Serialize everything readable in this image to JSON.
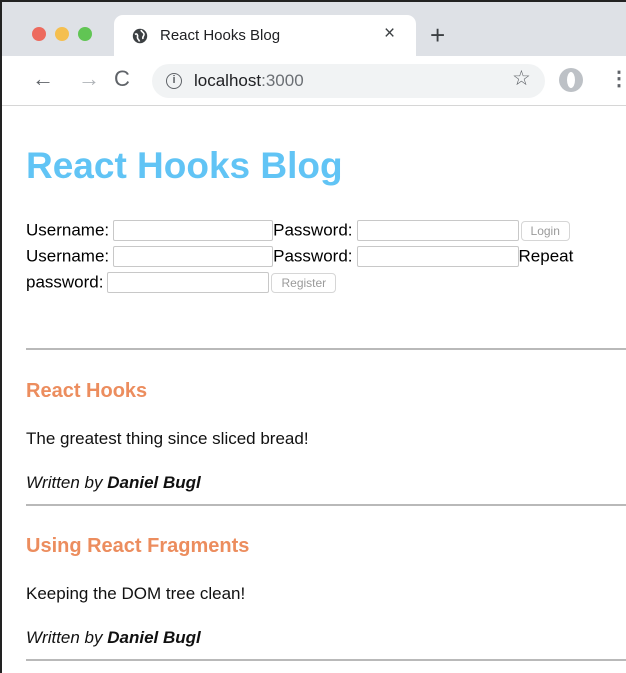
{
  "browser": {
    "tab_title": "React Hooks Blog",
    "tab_close": "×",
    "new_tab": "+",
    "url_host": "localhost",
    "url_port": ":3000",
    "info_glyph": "i",
    "icons": [
      "close-dot",
      "minimize-dot",
      "maximize-dot",
      "globe-icon",
      "back-icon",
      "forward-icon",
      "reload-icon",
      "star-icon",
      "profile-icon",
      "menu-icon"
    ]
  },
  "site": {
    "title": "React Hooks Blog"
  },
  "login": {
    "username_label": "Username:",
    "password_label": "Password:",
    "button": "Login"
  },
  "register": {
    "username_label": "Username:",
    "password_label": "Password:",
    "repeat_label_part1": "Repeat",
    "repeat_label_part2": "password:",
    "button": "Register"
  },
  "posts": [
    {
      "title": "React Hooks",
      "content": "The greatest thing since sliced bread!",
      "written_by": "Written by ",
      "author": "Daniel Bugl"
    },
    {
      "title": "Using React Fragments",
      "content": "Keeping the DOM tree clean!",
      "written_by": "Written by ",
      "author": "Daniel Bugl"
    }
  ],
  "colors": {
    "title": "#61c4f5",
    "post_title": "#ec8d5e",
    "divider": "#b9b9b9"
  }
}
